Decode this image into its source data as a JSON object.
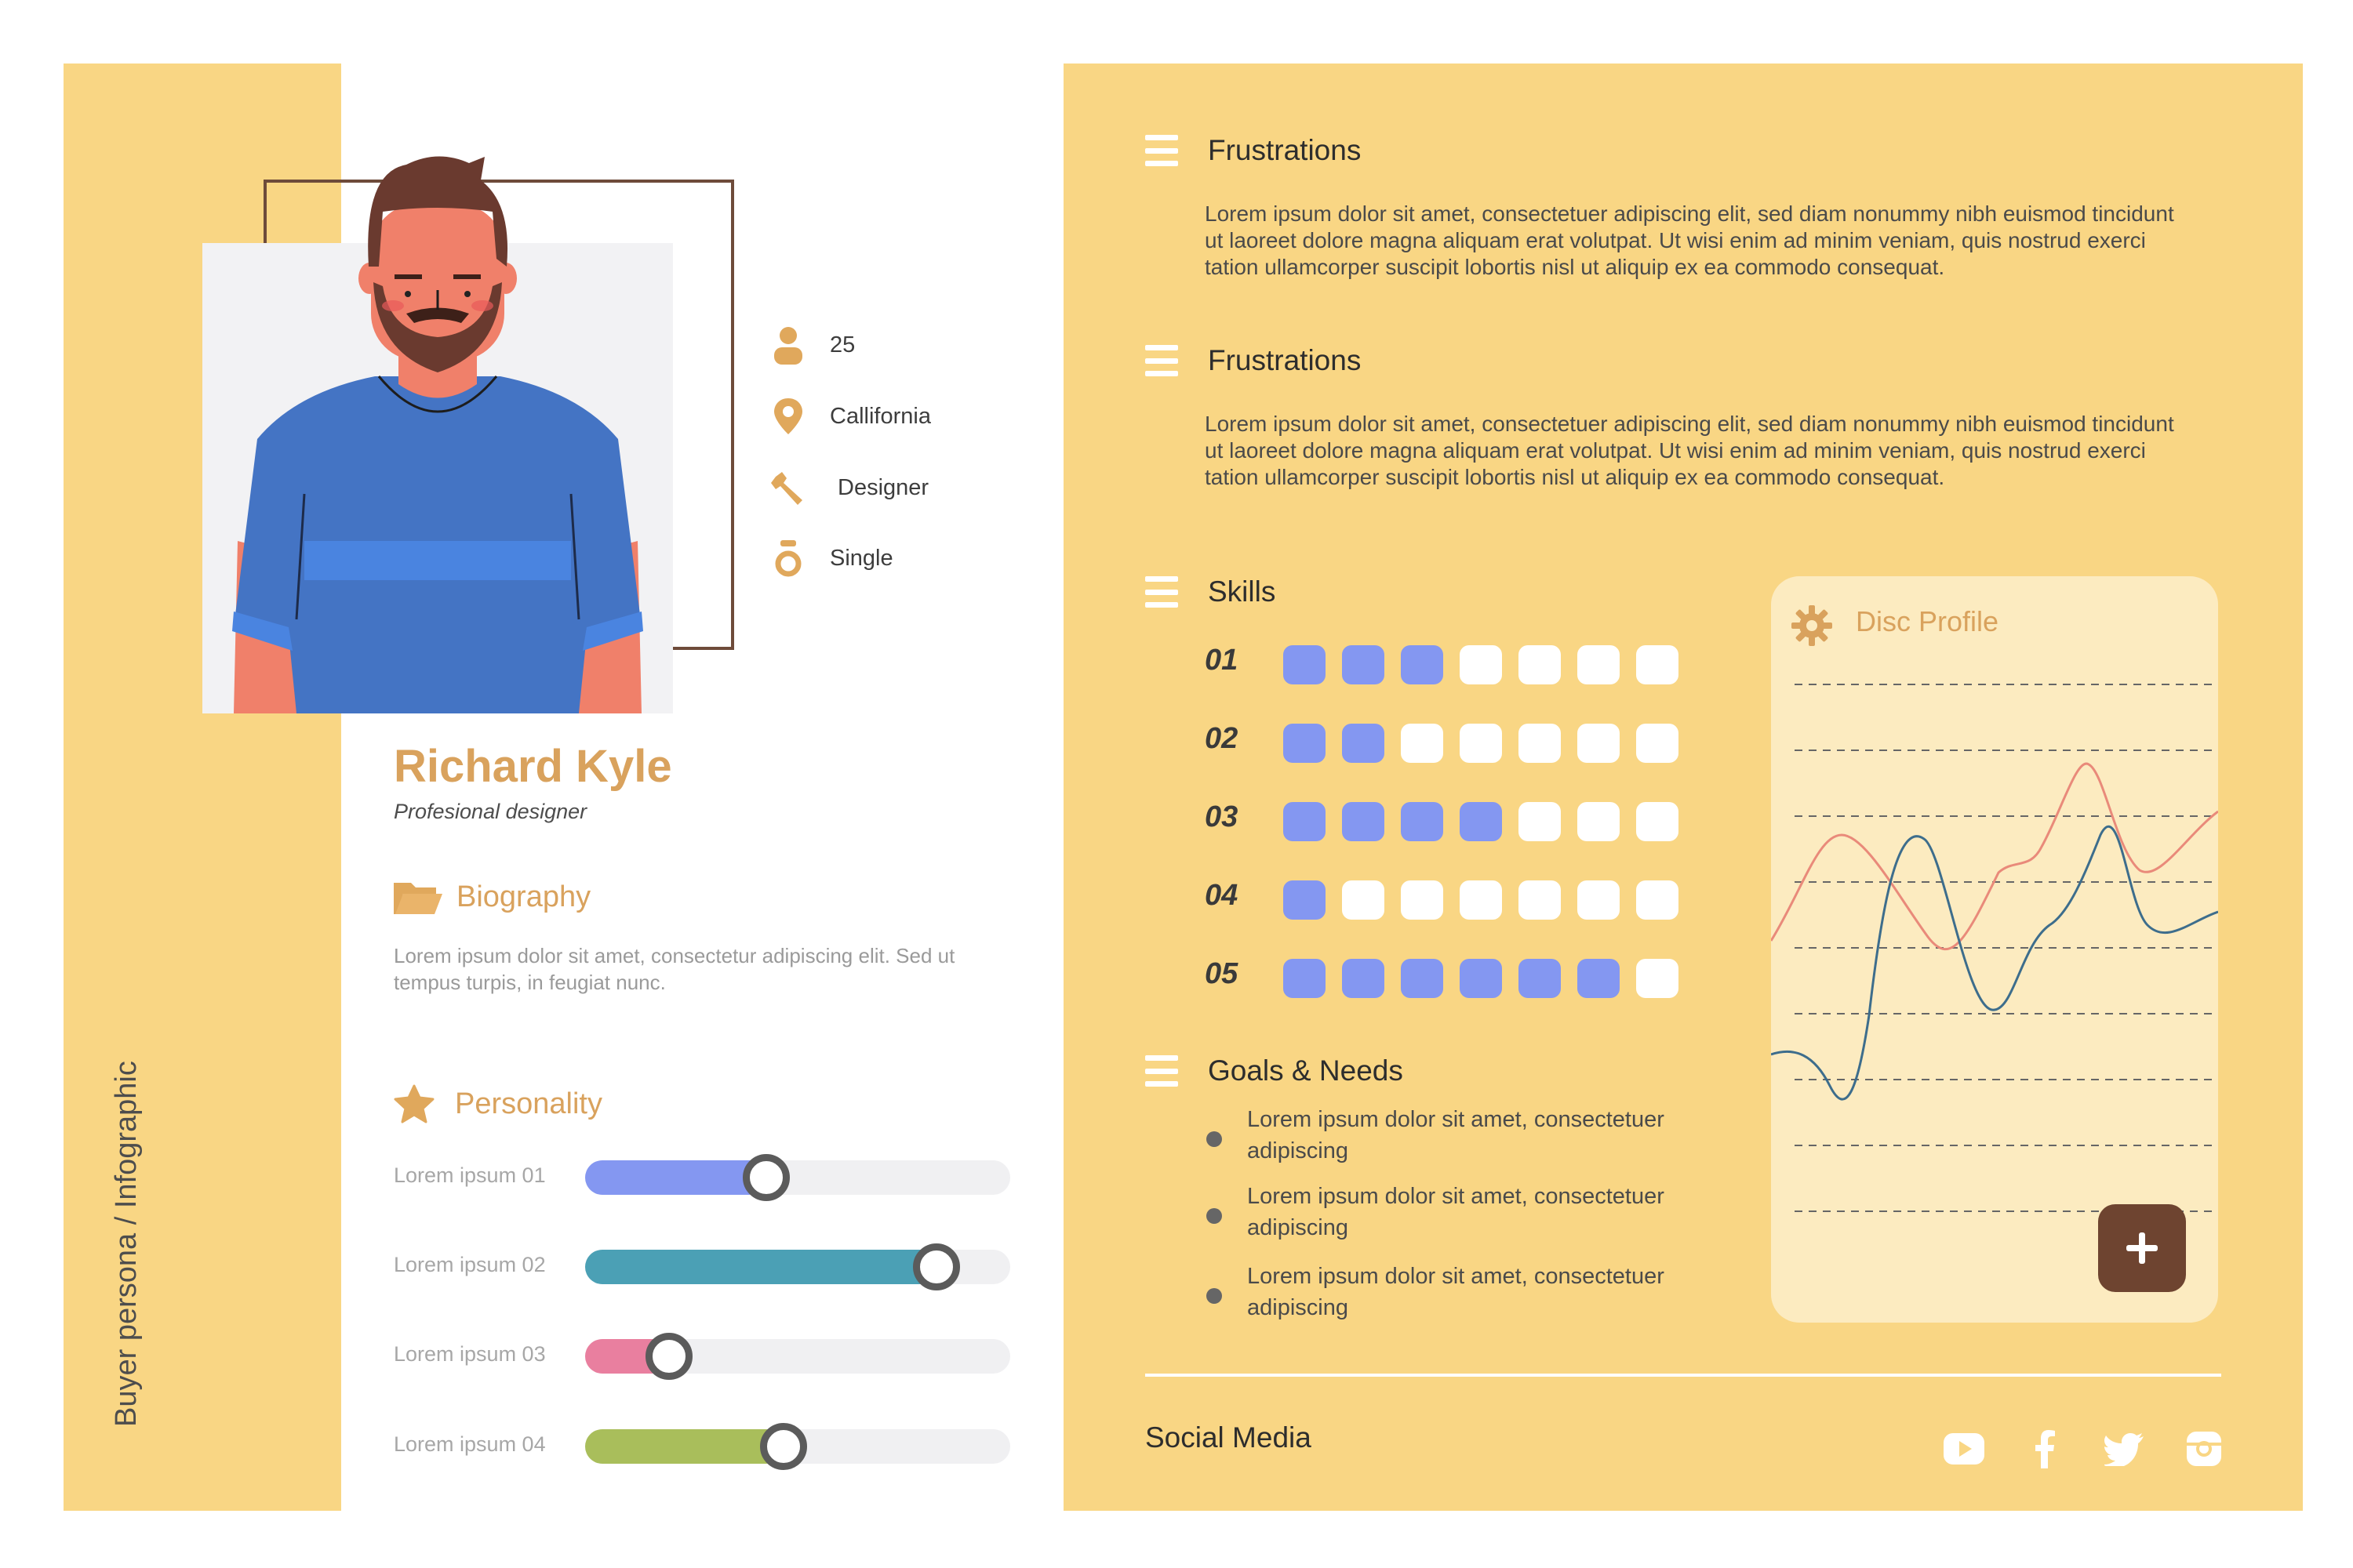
{
  "sidebar": {
    "vertical_label": "Buyer persona / Infographic"
  },
  "profile": {
    "name": "Richard Kyle",
    "role": "Profesional designer",
    "info": [
      {
        "icon": "user-icon",
        "text": "25"
      },
      {
        "icon": "location-pin-icon",
        "text": "Callifornia"
      },
      {
        "icon": "wrench-icon",
        "text": "Designer"
      },
      {
        "icon": "ring-icon",
        "text": "Single"
      }
    ]
  },
  "biography": {
    "title": "Biography",
    "text": "Lorem ipsum dolor sit amet, consectetur adipiscing elit. Sed ut tempus turpis, in feugiat nunc."
  },
  "personality": {
    "title": "Personality",
    "traits": [
      {
        "label": "Lorem ipsum 01",
        "value": 0.39,
        "color": "#8497f1"
      },
      {
        "label": "Lorem ipsum 02",
        "value": 0.79,
        "color": "#4ba0b5"
      },
      {
        "label": "Lorem ipsum 03",
        "value": 0.16,
        "color": "#e97f9f"
      },
      {
        "label": "Lorem ipsum 04",
        "value": 0.43,
        "color": "#a9be5b"
      }
    ]
  },
  "frustrations": [
    {
      "title": "Frustrations",
      "text": "Lorem ipsum dolor sit amet, consectetuer adipiscing elit, sed diam nonummy nibh euismod tincidunt ut laoreet dolore magna aliquam erat volutpat. Ut wisi enim ad minim veniam, quis nostrud exerci tation ullamcorper suscipit lobortis nisl ut aliquip ex ea commodo consequat."
    },
    {
      "title": "Frustrations",
      "text": "Lorem ipsum dolor sit amet, consectetuer adipiscing elit, sed diam nonummy nibh euismod tincidunt ut laoreet dolore magna aliquam erat volutpat. Ut wisi enim ad minim veniam, quis nostrud exerci tation ullamcorper suscipit lobortis nisl ut aliquip ex ea commodo consequat."
    }
  ],
  "skills": {
    "title": "Skills",
    "max": 7,
    "items": [
      {
        "label": "01",
        "level": 3
      },
      {
        "label": "02",
        "level": 2
      },
      {
        "label": "03",
        "level": 4
      },
      {
        "label": "04",
        "level": 1
      },
      {
        "label": "05",
        "level": 6
      }
    ]
  },
  "goals": {
    "title": "Goals & Needs",
    "items": [
      "Lorem ipsum dolor sit amet, consectetuer adipiscing",
      " Lorem ipsum dolor sit amet, consectetuer adipiscing",
      "Lorem ipsum dolor sit amet, consectetuer adipiscing"
    ]
  },
  "disc_profile": {
    "title": "Disc Profile",
    "add_icon": "plus-icon"
  },
  "social": {
    "title": "Social Media",
    "icons": [
      "youtube-icon",
      "facebook-icon",
      "twitter-icon",
      "instagram-icon"
    ]
  },
  "colors": {
    "panel": "#f9d684",
    "accent": "#d9a25d",
    "skill_on": "#8497f1",
    "disc_line_red": "#e98a7a",
    "disc_line_blue": "#3d6d8c",
    "add_button": "#6e4430"
  }
}
